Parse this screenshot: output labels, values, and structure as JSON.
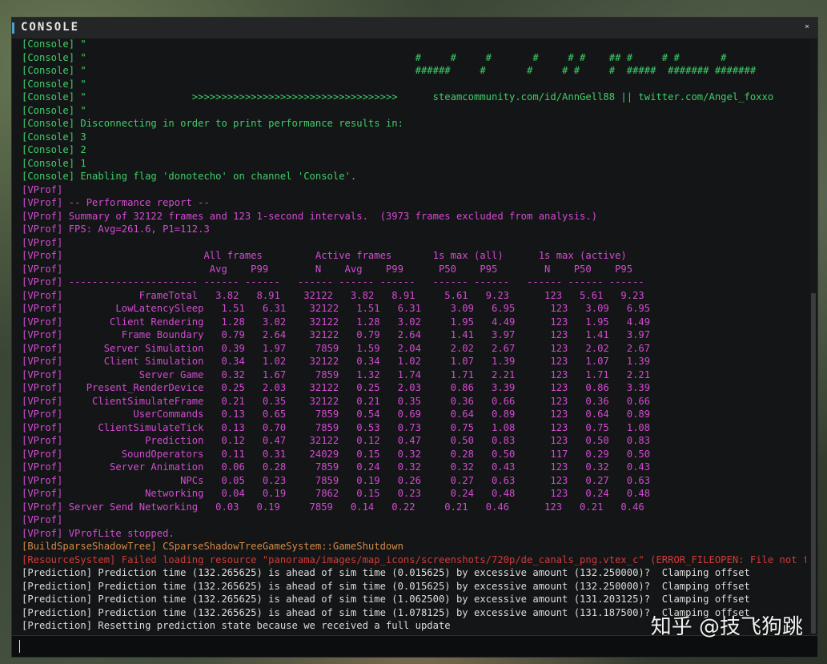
{
  "window": {
    "title": "CONSOLE",
    "close_label": "×"
  },
  "log": {
    "lines": [
      {
        "type": "console",
        "text": "[Console] \""
      },
      {
        "type": "console",
        "text": "[Console] \"                                                        #     #     #       #     # #    ## #     # #       #"
      },
      {
        "type": "console",
        "text": "[Console] \"                                                        ######     #       #     # #     #  #####  ####### #######"
      },
      {
        "type": "console",
        "text": "[Console] \""
      },
      {
        "type": "console",
        "text": "[Console] \"                  >>>>>>>>>>>>>>>>>>>>>>>>>>>>>>>>>>>      steamcommunity.com/id/AnnGell88 || twitter.com/Angel_foxxo      <<<<<<<<<<<<<<<<<<<<<<<<<<<<<<<<<<<"
      },
      {
        "type": "console",
        "text": "[Console] \""
      },
      {
        "type": "console",
        "text": "[Console] Disconnecting in order to print performance results in:"
      },
      {
        "type": "console",
        "text": "[Console] 3"
      },
      {
        "type": "console",
        "text": "[Console] 2"
      },
      {
        "type": "console",
        "text": "[Console] 1"
      },
      {
        "type": "console",
        "text": "[Console] Enabling flag 'donotecho' on channel 'Console'."
      },
      {
        "type": "vprof",
        "text": "[VProf]"
      },
      {
        "type": "vprof",
        "text": "[VProf] -- Performance report --"
      },
      {
        "type": "vprof",
        "text": "[VProf] Summary of 32122 frames and 123 1-second intervals.  (3973 frames excluded from analysis.)"
      },
      {
        "type": "vprof",
        "text": "[VProf] FPS: Avg=261.6, P1=112.3"
      },
      {
        "type": "vprof",
        "text": "[VProf]"
      },
      {
        "type": "vprof",
        "text": "[VProf]                        All frames         Active frames       1s max (all)      1s max (active)"
      },
      {
        "type": "vprof",
        "text": "[VProf]                         Avg    P99        N    Avg    P99      P50    P95        N    P50    P95"
      },
      {
        "type": "vprof",
        "text": "[VProf] ---------------------- ------ ------   ------ ------ ------   ------ ------   ------ ------ ------"
      },
      {
        "type": "vprof",
        "text": "[VProf]             FrameTotal   3.82   8.91    32122   3.82   8.91     5.61   9.23      123   5.61   9.23"
      },
      {
        "type": "vprof",
        "text": "[VProf]         LowLatencySleep   1.51   6.31    32122   1.51   6.31     3.09   6.95      123   3.09   6.95"
      },
      {
        "type": "vprof",
        "text": "[VProf]        Client Rendering   1.28   3.02    32122   1.28   3.02     1.95   4.49      123   1.95   4.49"
      },
      {
        "type": "vprof",
        "text": "[VProf]          Frame Boundary   0.79   2.64    32122   0.79   2.64     1.41   3.97      123   1.41   3.97"
      },
      {
        "type": "vprof",
        "text": "[VProf]       Server Simulation   0.39   1.97     7859   1.59   2.04     2.02   2.67      123   2.02   2.67"
      },
      {
        "type": "vprof",
        "text": "[VProf]       Client Simulation   0.34   1.02    32122   0.34   1.02     1.07   1.39      123   1.07   1.39"
      },
      {
        "type": "vprof",
        "text": "[VProf]             Server Game   0.32   1.67     7859   1.32   1.74     1.71   2.21      123   1.71   2.21"
      },
      {
        "type": "vprof",
        "text": "[VProf]    Present_RenderDevice   0.25   2.03    32122   0.25   2.03     0.86   3.39      123   0.86   3.39"
      },
      {
        "type": "vprof",
        "text": "[VProf]     ClientSimulateFrame   0.21   0.35    32122   0.21   0.35     0.36   0.66      123   0.36   0.66"
      },
      {
        "type": "vprof",
        "text": "[VProf]            UserCommands   0.13   0.65     7859   0.54   0.69     0.64   0.89      123   0.64   0.89"
      },
      {
        "type": "vprof",
        "text": "[VProf]      ClientSimulateTick   0.13   0.70     7859   0.53   0.73     0.75   1.08      123   0.75   1.08"
      },
      {
        "type": "vprof",
        "text": "[VProf]              Prediction   0.12   0.47    32122   0.12   0.47     0.50   0.83      123   0.50   0.83"
      },
      {
        "type": "vprof",
        "text": "[VProf]          SoundOperators   0.11   0.31    24029   0.15   0.32     0.28   0.50      117   0.29   0.50"
      },
      {
        "type": "vprof",
        "text": "[VProf]        Server Animation   0.06   0.28     7859   0.24   0.32     0.32   0.43      123   0.32   0.43"
      },
      {
        "type": "vprof",
        "text": "[VProf]                    NPCs   0.05   0.23     7859   0.19   0.26     0.27   0.63      123   0.27   0.63"
      },
      {
        "type": "vprof",
        "text": "[VProf]              Networking   0.04   0.19     7862   0.15   0.23     0.24   0.48      123   0.24   0.48"
      },
      {
        "type": "vprof",
        "text": "[VProf] Server Send Networking   0.03   0.19     7859   0.14   0.22     0.21   0.46      123   0.21   0.46"
      },
      {
        "type": "vprof",
        "text": "[VProf]"
      },
      {
        "type": "vprof",
        "text": "[VProf] VProfLite stopped."
      },
      {
        "type": "build",
        "text": "[BuildSparseShadowTree] CSparseShadowTreeGameSystem::GameShutdown"
      },
      {
        "type": "error",
        "text": "[ResourceSystem] Failed loading resource \"panorama/images/map_icons/screenshots/720p/de_canals_png.vtex_c\" (ERROR_FILEOPEN: File not found)"
      },
      {
        "type": "pred",
        "text": "[Prediction] Prediction time (132.265625) is ahead of sim time (0.015625) by excessive amount (132.250000)?  Clamping offset"
      },
      {
        "type": "pred",
        "text": "[Prediction] Prediction time (132.265625) is ahead of sim time (0.015625) by excessive amount (132.250000)?  Clamping offset"
      },
      {
        "type": "pred",
        "text": "[Prediction] Prediction time (132.265625) is ahead of sim time (1.062500) by excessive amount (131.203125)?  Clamping offset"
      },
      {
        "type": "pred",
        "text": "[Prediction] Prediction time (132.265625) is ahead of sim time (1.078125) by excessive amount (131.187500)?  Clamping offset"
      },
      {
        "type": "pred",
        "text": "[Prediction] Resetting prediction state because we received a full update"
      }
    ]
  },
  "input": {
    "value": "",
    "placeholder": ""
  },
  "watermark": "知乎 @技飞狗跳",
  "colors": {
    "console": "#3fcf6a",
    "vprof": "#d24bd2",
    "build": "#d08a4a",
    "error": "#d23a3a",
    "prediction": "#dcdcdc"
  }
}
